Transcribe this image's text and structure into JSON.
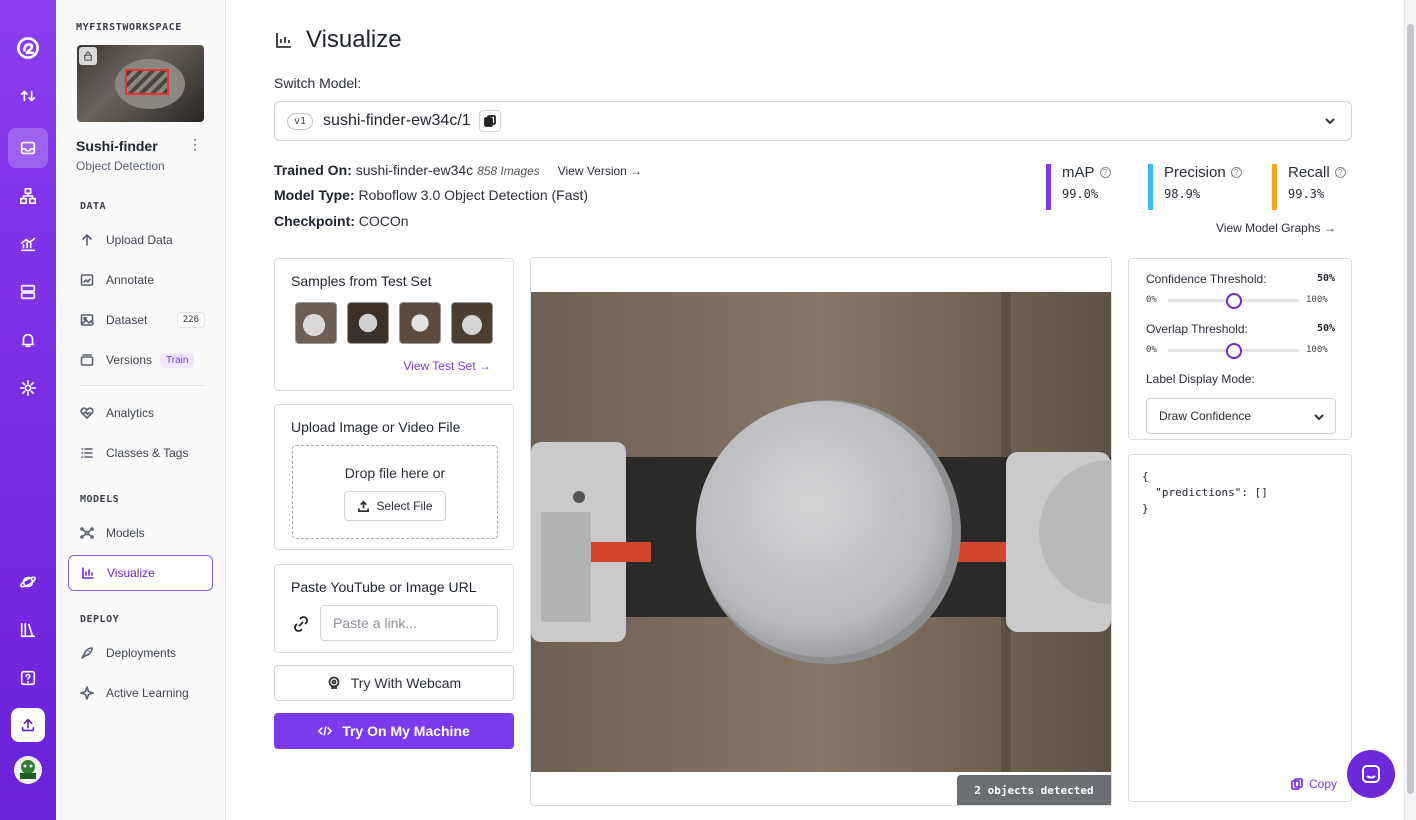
{
  "workspace": "MYFIRSTWORKSPACE",
  "project": {
    "name": "Sushi-finder",
    "type": "Object Detection",
    "menu_icon": "more-vertical-icon"
  },
  "sidebar": {
    "sections": {
      "data": "DATA",
      "models": "MODELS",
      "deploy": "DEPLOY"
    },
    "items": [
      {
        "label": "Upload Data",
        "icon": "upload-arrow-icon"
      },
      {
        "label": "Annotate",
        "icon": "annotate-icon"
      },
      {
        "label": "Dataset",
        "icon": "image-icon",
        "badge": "226"
      },
      {
        "label": "Versions",
        "icon": "versions-icon",
        "badge": "Train"
      },
      {
        "label": "Analytics",
        "icon": "heart-pulse-icon"
      },
      {
        "label": "Classes & Tags",
        "icon": "list-icon"
      },
      {
        "label": "Models",
        "icon": "graph-nodes-icon"
      },
      {
        "label": "Visualize",
        "icon": "chart-icon",
        "active": true
      },
      {
        "label": "Deployments",
        "icon": "rocket-icon"
      },
      {
        "label": "Active Learning",
        "icon": "sparkle-icon"
      }
    ]
  },
  "page": {
    "title": "Visualize",
    "switch_model_label": "Switch Model:"
  },
  "model_select": {
    "version": "v1",
    "name": "sushi-finder-ew34c/1"
  },
  "trained_on": {
    "label": "Trained On:",
    "value": "sushi-finder-ew34c",
    "images": "858 Images",
    "link": "View Version →"
  },
  "model_type": {
    "label": "Model Type:",
    "value": "Roboflow 3.0 Object Detection (Fast)"
  },
  "checkpoint": {
    "label": "Checkpoint:",
    "value": "COCOn"
  },
  "metrics": [
    {
      "label": "mAP",
      "value": "99.0%",
      "color": "#7c3aed"
    },
    {
      "label": "Precision",
      "value": "98.9%",
      "color": "#38bdf8"
    },
    {
      "label": "Recall",
      "value": "99.3%",
      "color": "#f5a623"
    }
  ],
  "view_model_graphs": "View Model Graphs →",
  "samples": {
    "title": "Samples from Test Set",
    "link": "View Test Set →"
  },
  "upload": {
    "title": "Upload Image or Video File",
    "drop_text": "Drop file here or",
    "button": "Select File"
  },
  "url_card": {
    "title": "Paste YouTube or Image URL",
    "placeholder": "Paste a link..."
  },
  "webcam_button": "Try With Webcam",
  "machine_button": "Try On My Machine",
  "objects_detected": "2 objects detected",
  "controls": {
    "confidence": {
      "label": "Confidence Threshold:",
      "value": "50%",
      "min": "0%",
      "max": "100%",
      "level": 0.5
    },
    "overlap": {
      "label": "Overlap Threshold:",
      "value": "50%",
      "min": "0%",
      "max": "100%",
      "level": 0.5
    },
    "label_mode": {
      "label": "Label Display Mode:",
      "value": "Draw Confidence"
    }
  },
  "json_output": "{\n  \"predictions\": []\n}",
  "copy_label": "Copy"
}
